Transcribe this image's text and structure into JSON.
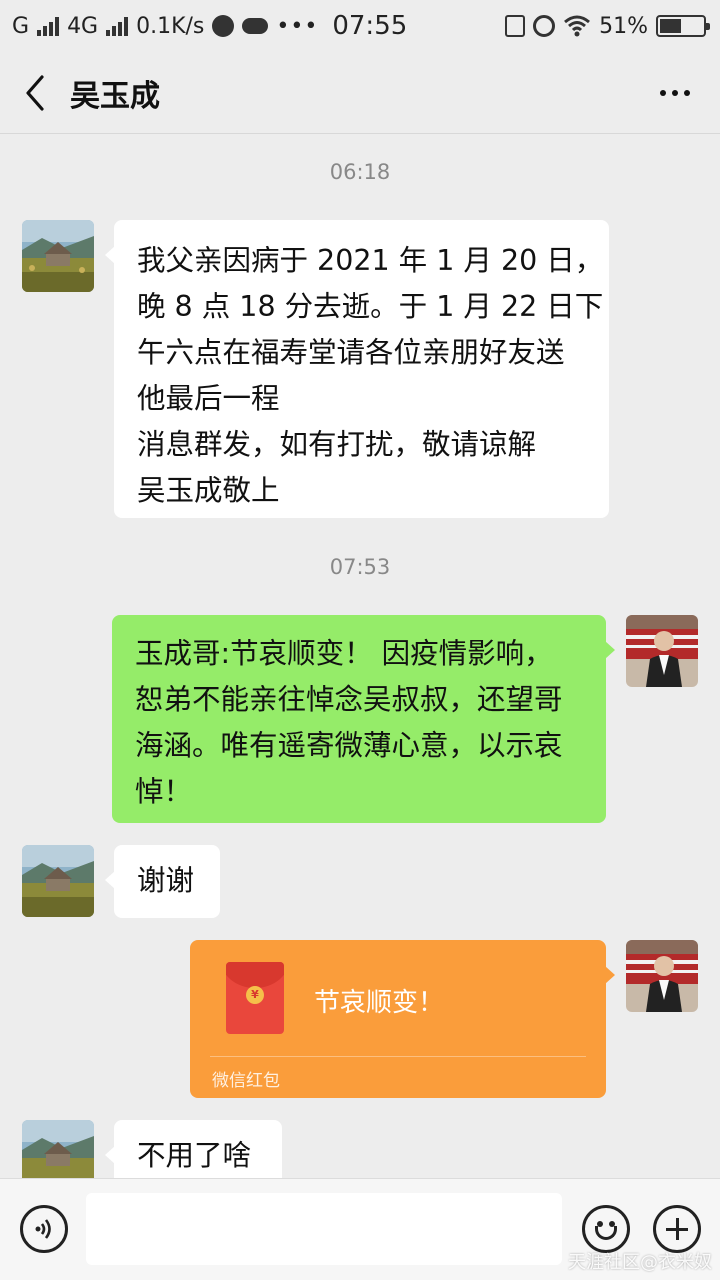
{
  "status_bar": {
    "left_text": "G",
    "network": "4G",
    "speed": "0.1K/s",
    "time": "07:55",
    "battery": "51%",
    "battery_level": 0.51,
    "more": "•••"
  },
  "header": {
    "title": "吴玉成"
  },
  "messages": {
    "t1": "06:18",
    "m1": "我父亲因病于 2021 年 1 月 20 日，\n晚 8 点 18 分去逝。于 1 月 22 日下\n午六点在福寿堂请各位亲朋好友送\n他最后一程\n消息群发，如有打扰，敬请谅解\n吴玉成敬上",
    "t2": "07:53",
    "m2": "玉成哥:节哀顺变！ 因疫情影响，\n恕弟不能亲往悼念吴叔叔，还望哥\n海涵。唯有遥寄微薄心意，以示哀\n悼！",
    "m3": "谢谢",
    "red_packet": {
      "greeting": "节哀顺变！",
      "label": "微信红包",
      "coin": "¥"
    },
    "m4": "不用了啥"
  },
  "input_bar": {
    "placeholder": ""
  },
  "watermark": "天涯社区@衣米奴",
  "colors": {
    "background": "#ededed",
    "sent_bubble": "#95ec69",
    "received_bubble": "#ffffff",
    "red_packet": "#fa9d3b",
    "red_packet_icon": "#e9473c"
  }
}
